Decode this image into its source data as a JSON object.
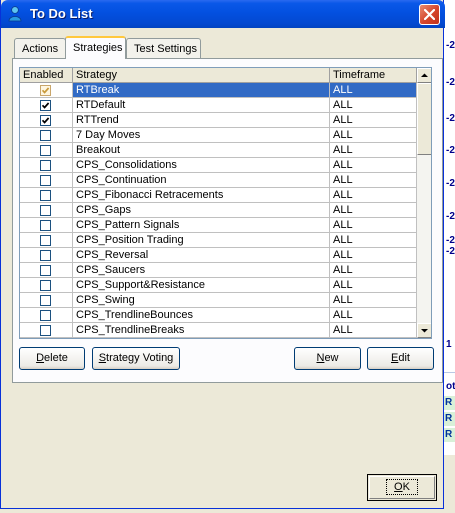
{
  "window": {
    "title": "To Do List"
  },
  "tabs": [
    {
      "label": "Actions",
      "active": false
    },
    {
      "label": "Strategies",
      "active": true
    },
    {
      "label": "Test Settings",
      "active": false
    }
  ],
  "grid": {
    "columns": [
      "Enabled",
      "Strategy",
      "Timeframe"
    ],
    "rows": [
      {
        "enabled": true,
        "strategy": "RTBreak",
        "timeframe": "ALL",
        "selected": true
      },
      {
        "enabled": true,
        "strategy": "RTDefault",
        "timeframe": "ALL"
      },
      {
        "enabled": true,
        "strategy": "RTTrend",
        "timeframe": "ALL"
      },
      {
        "enabled": false,
        "strategy": "7 Day Moves",
        "timeframe": "ALL"
      },
      {
        "enabled": false,
        "strategy": "Breakout",
        "timeframe": "ALL"
      },
      {
        "enabled": false,
        "strategy": "CPS_Consolidations",
        "timeframe": "ALL"
      },
      {
        "enabled": false,
        "strategy": "CPS_Continuation",
        "timeframe": "ALL"
      },
      {
        "enabled": false,
        "strategy": "CPS_Fibonacci Retracements",
        "timeframe": "ALL"
      },
      {
        "enabled": false,
        "strategy": "CPS_Gaps",
        "timeframe": "ALL"
      },
      {
        "enabled": false,
        "strategy": "CPS_Pattern Signals",
        "timeframe": "ALL"
      },
      {
        "enabled": false,
        "strategy": "CPS_Position Trading",
        "timeframe": "ALL"
      },
      {
        "enabled": false,
        "strategy": "CPS_Reversal",
        "timeframe": "ALL"
      },
      {
        "enabled": false,
        "strategy": "CPS_Saucers",
        "timeframe": "ALL"
      },
      {
        "enabled": false,
        "strategy": "CPS_Support&Resistance",
        "timeframe": "ALL"
      },
      {
        "enabled": false,
        "strategy": "CPS_Swing",
        "timeframe": "ALL"
      },
      {
        "enabled": false,
        "strategy": "CPS_TrendlineBounces",
        "timeframe": "ALL"
      },
      {
        "enabled": false,
        "strategy": "CPS_TrendlineBreaks",
        "timeframe": "ALL"
      }
    ]
  },
  "buttons": {
    "delete": {
      "pre": "",
      "key": "D",
      "post": "elete"
    },
    "strategy_voting": {
      "pre": "",
      "key": "S",
      "post": "trategy Voting"
    },
    "new": {
      "pre": "",
      "key": "N",
      "post": "ew"
    },
    "edit": {
      "pre": "",
      "key": "E",
      "post": "dit"
    },
    "ok": {
      "pre": "",
      "key": "O",
      "post": "K"
    }
  },
  "background_app": {
    "labels": [
      "-2",
      "-2",
      "-2",
      "-2",
      "-2",
      "-2",
      "-2",
      "-2",
      "2",
      "2",
      "1",
      "ot",
      "R",
      "R",
      "R"
    ]
  },
  "colors": {
    "title_bar": "#0350E0",
    "selection": "#316AC5",
    "close_button": "#D5442A",
    "active_tab_accent": "#FFC83C"
  },
  "icons": {
    "app": "user-icon",
    "close": "close-icon",
    "check": "checkmark-icon",
    "scroll_up": "arrow-up-icon",
    "scroll_down": "arrow-down-icon"
  }
}
